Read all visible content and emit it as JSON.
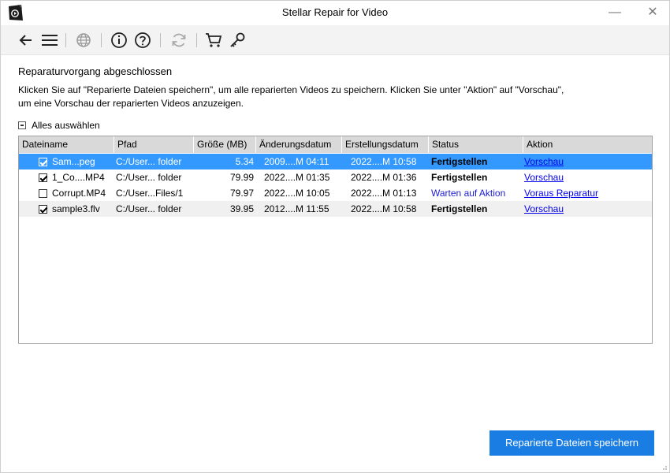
{
  "window": {
    "title": "Stellar Repair for Video",
    "minimize_glyph": "—",
    "close_glyph": "✕"
  },
  "toolbar": {
    "icons": [
      "back-arrow-icon",
      "menu-icon",
      "globe-icon",
      "info-icon",
      "help-icon",
      "refresh-icon",
      "cart-icon",
      "key-icon"
    ]
  },
  "main": {
    "heading": "Reparaturvorgang abgeschlossen",
    "description": "Klicken Sie auf \"Reparierte Dateien speichern\", um alle reparierten Videos zu speichern. Klicken Sie unter \"Aktion\" auf \"Vorschau\", um eine Vorschau der reparierten Videos anzuzeigen.",
    "select_all_label": "Alles auswählen"
  },
  "table": {
    "columns": [
      "Dateiname",
      "Pfad",
      "Größe (MB)",
      "Änderungsdatum",
      "Erstellungsdatum",
      "Status",
      "Aktion"
    ],
    "rows": [
      {
        "checked": true,
        "name": "Sam...peg",
        "path": "C:/User... folder",
        "size": "5.34",
        "modified": "2009....M 04:11",
        "created": "2022....M 10:58",
        "status": "Fertigstellen",
        "action": "Vorschau"
      },
      {
        "checked": true,
        "name": "1_Co....MP4",
        "path": "C:/User... folder",
        "size": "79.99",
        "modified": "2022....M 01:35",
        "created": "2022....M 01:36",
        "status": "Fertigstellen",
        "action": "Vorschau"
      },
      {
        "checked": false,
        "name": "Corrupt.MP4",
        "path": "C:/User...Files/1",
        "size": "79.97",
        "modified": "2022....M 10:05",
        "created": "2022....M 01:13",
        "status": "Warten auf Aktion",
        "action": "Voraus Reparatur"
      },
      {
        "checked": true,
        "name": "sample3.flv",
        "path": "C:/User... folder",
        "size": "39.95",
        "modified": "2012....M 11:55",
        "created": "2022....M 10:58",
        "status": "Fertigstellen",
        "action": "Vorschau"
      }
    ]
  },
  "footer": {
    "save_button_label": "Reparierte Dateien speichern"
  },
  "colors": {
    "accent": "#1a7de3",
    "selection": "#3399ff",
    "link": "#0000ee",
    "waiting_status": "#1c1cd6"
  }
}
